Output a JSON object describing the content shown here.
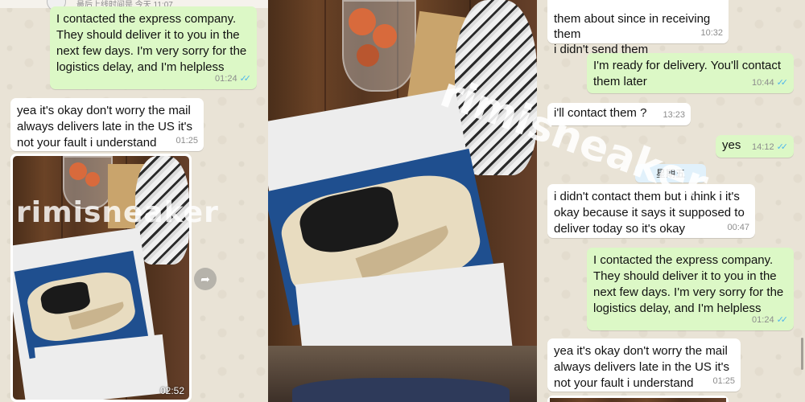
{
  "colors": {
    "outgoing_bubble": "#dcf8c6",
    "incoming_bubble": "#ffffff",
    "read_ticks": "#4fb6ec",
    "chat_bg": "#e9e3d6"
  },
  "watermark": "rimisneaker",
  "panel_left": {
    "header_status": "最后上线时间是 今天 11:07",
    "messages": [
      {
        "direction": "out",
        "text": "I contacted the express company. They should deliver it to you in the next few days. I'm very sorry for the logistics delay, and I'm helpless",
        "time": "01:24",
        "read": true
      },
      {
        "direction": "in",
        "text": "yea it's okay don't worry the mail always delivers late in the US it's not your fault i understand",
        "time": "01:25"
      }
    ],
    "video": {
      "duration": "02:52",
      "forward_icon": "forward-icon"
    }
  },
  "panel_right": {
    "messages": [
      {
        "direction": "in",
        "text": "them about since in receiving them\ni didn't send them",
        "time": "10:32"
      },
      {
        "direction": "out",
        "text": "I'm ready for delivery. You'll contact\nthem later",
        "time": "10:44",
        "read": true
      },
      {
        "direction": "in",
        "text": "i'll contact them ?",
        "time": "13:23"
      },
      {
        "direction": "out",
        "text": "yes",
        "time": "14:12",
        "read": true
      },
      {
        "direction": "in",
        "text": "i didn't contact them but i think i it's okay because it says it supposed to deliver today so it's okay",
        "time": "00:47"
      },
      {
        "direction": "out",
        "text": "I contacted the express company. They should deliver it to you in the next few days. I'm very sorry for the logistics delay, and I'm helpless",
        "time": "01:24",
        "read": true
      },
      {
        "direction": "in",
        "text": "yea it's okay don't worry the mail always delivers late in the US it's not your fault i understand",
        "time": "01:25"
      }
    ],
    "day_separator": "星期五"
  }
}
